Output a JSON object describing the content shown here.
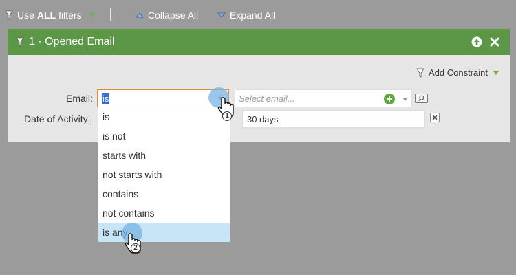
{
  "toolbar": {
    "use_prefix": "Use",
    "use_bold": "ALL",
    "use_suffix": "filters",
    "collapse_all": "Collapse All",
    "expand_all": "Expand All"
  },
  "filter": {
    "title": "1 - Opened Email",
    "add_constraint": "Add Constraint",
    "email_label": "Email:",
    "date_label": "Date of Activity:",
    "operator_selected": "is",
    "email_placeholder": "Select email...",
    "date_value": "30 days"
  },
  "dropdown": {
    "options": [
      "is",
      "is not",
      "starts with",
      "not starts with",
      "contains",
      "not contains",
      "is any"
    ],
    "highlighted": "is any"
  },
  "steps": {
    "step1": "1",
    "step2": "2"
  },
  "colors": {
    "header_green": "#5c9748",
    "accent_green": "#6ab04c",
    "highlight_blue": "#c8e4f7",
    "selection_blue": "#3a6ad6",
    "background_gray": "#9b9b9b"
  },
  "icons": [
    "filter-icon",
    "chevron-down-icon",
    "collapse-icon",
    "expand-icon",
    "move-up-icon",
    "close-icon",
    "add-icon",
    "search-icon",
    "remove-icon",
    "hand-cursor-icon"
  ]
}
